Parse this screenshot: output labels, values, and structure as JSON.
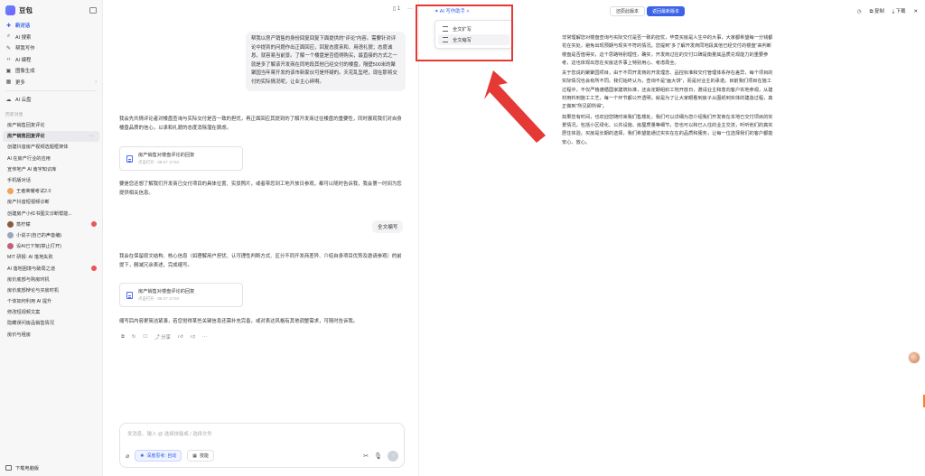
{
  "sidebar": {
    "brand": "豆包",
    "nav": [
      {
        "label": "新对话",
        "icon": "new-chat-icon"
      },
      {
        "label": "AI 搜索",
        "icon": "search-icon"
      },
      {
        "label": "帮我写作",
        "icon": "pen-icon"
      },
      {
        "label": "AI 编程",
        "icon": "code-icon"
      },
      {
        "label": "图像生成",
        "icon": "image-icon"
      },
      {
        "label": "更多",
        "icon": "grid-icon"
      }
    ],
    "cloud": {
      "label": "AI 云盘",
      "icon": "cloud-icon"
    },
    "history_label": "历史对话",
    "conversations": [
      {
        "label": "房产销售回复评论"
      },
      {
        "label": "房产销售回复评论"
      },
      {
        "label": "创建抖音房产视频选题框架体"
      },
      {
        "label": "AI 在房产行业的应用"
      },
      {
        "label": "宣传地产 AI 南宇知识库"
      },
      {
        "label": "手机版对话"
      },
      {
        "label": "王者荣耀考试2.0"
      },
      {
        "label": "房产抖音短视频诊断"
      },
      {
        "label": "创建房产小红书图文诊断帮能..."
      },
      {
        "label": "蒸柠檬"
      },
      {
        "label": "小说子(自己的声音编)"
      },
      {
        "label": "设AI已下架(禁止打开)"
      },
      {
        "label": "MIT 研报: AI 落地失败"
      },
      {
        "label": "AI 落地困境与破局之道"
      },
      {
        "label": "房价底部与购房时机"
      },
      {
        "label": "房价底部辩论与买房时机"
      },
      {
        "label": "个体如何利用 AI 提升"
      },
      {
        "label": "修改短视频文案"
      },
      {
        "label": "隐藏误问房品销售情况"
      },
      {
        "label": "房价与租房"
      }
    ],
    "bottom_label": "下载电脑版"
  },
  "chat": {
    "top_page_count": "1",
    "user_message": "帮我以房产销售的身份回复回复下面提供的\"评论\"内容。需要针对评论中提到的问题作出正面回应，回复态度亲和、用语礼貌；态度诚恳，就容易当前景。了解一个楼盘是否值得购买，最直接的方式之一就是多了解该开发商在同地段其他已经交付的楼盘，隔壁500米的聚聚园当年蒋开发的该市新家伙可是怀疑的。天花乱坠吧，现在那将交付的实际情况呢，让业主心碎啊。",
    "bot_reply_1": "我会先共情评论者对楼盘查询与实际交付是否一致的担忧，再正面回应其提到的了解开发商过往楼盘的重要性，同时展现我们对自身楼盘品质的信心，以承和礼貌的态度消除潜在顾虑。",
    "doc_card_title": "房产销售对楼盘评论的回复",
    "doc_card_meta": "点击打开 · 08-27 17:03",
    "bot_reply_2": "要是您还想了解我们开发商已交付项目的具体位置、实景照片，或者带您到工地开放日参观，都可以随时告诉我，我会第一时间为您提供相关信息。",
    "user_chip": "全文编写",
    "bot_reply_3": "我会在保留原文结构、核心信息（如理解用户担忧、认可理性判断方式、区分不同开发商差异、介绍自身项目优势及邀请参观）的前提下，删减冗余表述，完成缩写。",
    "doc_card2_title": "房产销售对楼盘评论的回复",
    "doc_card2_meta": "点击打开 · 08-27 17:03",
    "bot_reply_4": "缩写后内容更简洁紧凑，若您觉得某些关键信息还需补充完善，或对表达风格有其他调整需求，可随时告诉我。",
    "share_label": "分享",
    "composer_placeholder": "发消息、输入 @ 选择技能或 / 选择文件",
    "chip_deep_thinking": "深度思考: 自动",
    "chip_skill": "技能"
  },
  "doc": {
    "ai_write_label": "AI 写作助手",
    "dropdown_items": [
      "全文扩写",
      "全文缩写"
    ],
    "btn_compare": "还原此版本",
    "btn_back": "返回最新版本",
    "tool_copy": "复制",
    "tool_download": "下载",
    "paragraphs": [
      "非常理解您对楼盘查询与实际交付是否一致的担忧，毕竟买房是人生中的大事，大家都希望每一分钱都花在实处，避免出现预期与现实不符的情况。您提到\"多了解开发商同地段其他已经交付的楼盘\"来判断楼盘是否值得买，这个思路特别理性，确实，开发商过往的交付口碑是衡量其品质兑现能力的重要参考，这也体现出您在买房这件事上特别用心、考虑周全。",
      "关于您说的聚聚园项目，由于不同开发商的开发理念、品控标准和交付管理体系存在差异，每个项目的实际情况也会有所不同。我们始终认为，查询不是\"画大饼\"，而是对业主的承诺。目前我们项目在施工过程中，不仅严格遵循国家建筑标准，还会定期组织工地开放日，邀请业主和意向客户实地参观，从建材用料到施工工艺，每一个环节都公开透明，就是为了让大家眼看到房子从图纸到实体的建造过程，真正做到\"所见即所得\"。",
      "如果您有时间，也欢迎您随时来我们售楼处，我们可以详细为您介绍我们开发商在本地已交付项目的实景情况，包括小区绿化、公共设施、房屋质量等细节，您也可以和已入住的业主交流，听听他们的真实居住体验。买房是长期的选择，我们希望能通过实实在在的品质和服务，让每一位选择我们的客户都能安心、放心。"
    ]
  },
  "colors": {
    "accent": "#3a63e8",
    "highlight": "#e53935",
    "sidebar_bg": "#f7f7f8"
  }
}
